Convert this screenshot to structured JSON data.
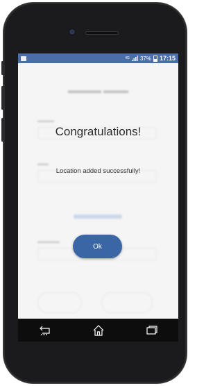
{
  "status_bar": {
    "network": "4G",
    "battery": "37%",
    "time": "17:15",
    "bar_color": "#4a6ea8"
  },
  "dialog": {
    "title": "Congratulations!",
    "message": "Location added successfully!",
    "ok_label": "Ok",
    "button_color": "#3a66a6"
  },
  "nav_bar": {
    "items": [
      "back-icon",
      "home-icon",
      "recent-apps-icon"
    ]
  }
}
